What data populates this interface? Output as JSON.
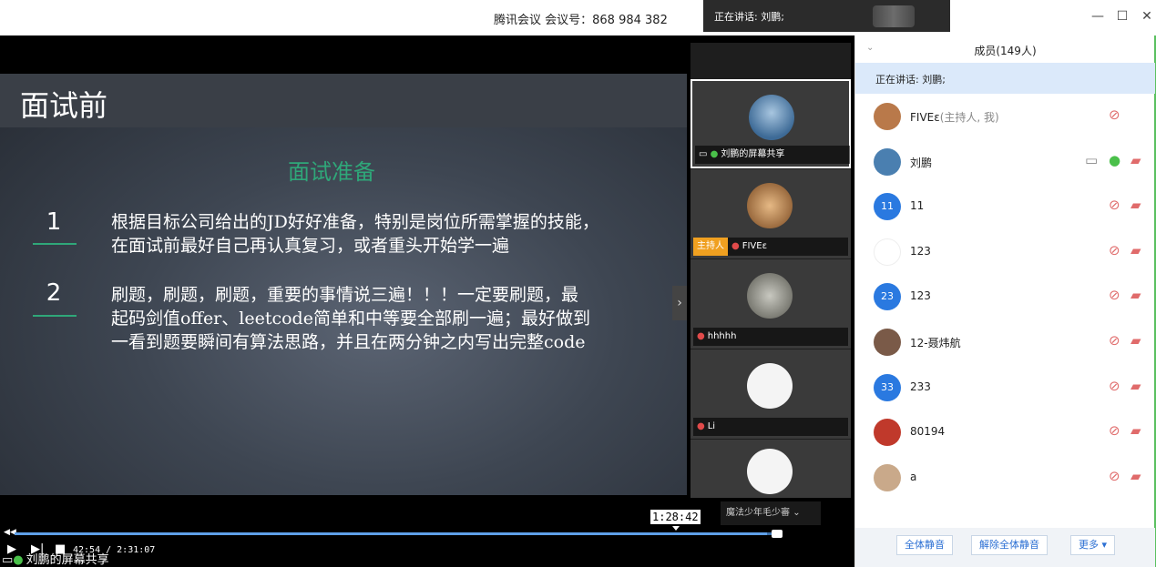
{
  "window": {
    "title": "腾讯会议 会议号：868 984 382",
    "speaking_popup": "正在讲话: 刘鹏;",
    "controls": {
      "minimize": "—",
      "maximize": "☐",
      "close": "✕"
    }
  },
  "slide": {
    "title": "面试前",
    "subtitle": "面试准备",
    "items": [
      {
        "num": "1",
        "lines": [
          "根据目标公司给出的JD好好准备，特别是岗位所需掌握的技能，",
          "在面试前最好自己再认真复习，或者重头开始学一遍"
        ]
      },
      {
        "num": "2",
        "lines": [
          "刷题，刷题，刷题，重要的事情说三遍！！！一定要刷题，最",
          "起码剑值offer、leetcode简单和中等要全部刷一遍；最好做到",
          "一看到题要瞬间有算法思路，并且在两分钟之内写出完整code"
        ]
      }
    ]
  },
  "video_tiles": [
    {
      "label": "刘鹏的屏幕共享",
      "host": "",
      "active": true,
      "color": "#4a7fb0"
    },
    {
      "label": "FIVEε",
      "host": "主持人",
      "active": false,
      "color": "#c98a52"
    },
    {
      "label": "hhhhh",
      "host": "",
      "active": false,
      "color": "#8a8a80"
    },
    {
      "label": "Li",
      "host": "",
      "active": false,
      "color": "#e8e8e8"
    },
    {
      "label": "",
      "host": "",
      "active": false,
      "color": "#f0f0f0"
    }
  ],
  "playback": {
    "hover_time": "1:28:42",
    "time": "42:54 / 2:31:07",
    "progress": 0.996,
    "share_label": "刘鹏的屏幕共享",
    "speaker_label": "魔法少年毛少審"
  },
  "members": {
    "header": "成员(149人)",
    "speaking": "正在讲话: 刘鹏;",
    "list": [
      {
        "name": "FIVEε",
        "role": "(主持人, 我)",
        "avatar_text": "",
        "avatar_color": "#b9794a",
        "share": false,
        "mic": "muted",
        "cam": false
      },
      {
        "name": "刘鹏",
        "role": "",
        "avatar_text": "",
        "avatar_color": "#4a7fb0",
        "share": true,
        "mic": "on",
        "cam": true
      },
      {
        "name": "11",
        "role": "",
        "avatar_text": "11",
        "avatar_color": "#2a79e0",
        "share": false,
        "mic": "muted",
        "cam": true
      },
      {
        "name": "123",
        "role": "",
        "avatar_text": "",
        "avatar_color": "#ffffff",
        "share": false,
        "mic": "muted",
        "cam": true
      },
      {
        "name": "123",
        "role": "",
        "avatar_text": "23",
        "avatar_color": "#2a79e0",
        "share": false,
        "mic": "muted",
        "cam": true
      },
      {
        "name": "12-聂炜航",
        "role": "",
        "avatar_text": "",
        "avatar_color": "#7a5a48",
        "share": false,
        "mic": "muted",
        "cam": true
      },
      {
        "name": "233",
        "role": "",
        "avatar_text": "33",
        "avatar_color": "#2a79e0",
        "share": false,
        "mic": "muted",
        "cam": true
      },
      {
        "name": "80194",
        "role": "",
        "avatar_text": "",
        "avatar_color": "#c0392b",
        "share": false,
        "mic": "muted",
        "cam": true
      },
      {
        "name": "a",
        "role": "",
        "avatar_text": "",
        "avatar_color": "#c9a98a",
        "share": false,
        "mic": "muted",
        "cam": true
      }
    ],
    "footer": {
      "mute_all": "全体静音",
      "unmute_all": "解除全体静音",
      "more": "更多 ▾"
    }
  }
}
